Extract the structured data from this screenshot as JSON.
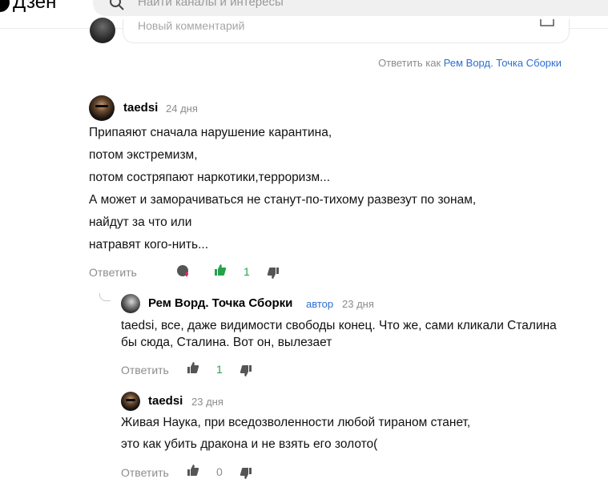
{
  "header": {
    "logo_text": "Дзен",
    "search_placeholder": "Найти каналы и интересы"
  },
  "new_comment": {
    "placeholder": "Новый комментарий"
  },
  "reply_as": {
    "prefix": "Ответить как",
    "name": "Рем Ворд. Точка Сборки"
  },
  "comments": [
    {
      "author": "taedsi",
      "date": "24 дня",
      "lines": [
        "Припаяют сначала нарушение карантина,",
        "потом экстремизм,",
        "потом состряпают наркотики,терроризм...",
        "А может и заморачиваться не станут-по-тихому развезут по зонам,",
        "найдут за что или",
        "натравят кого-нить..."
      ],
      "reply_label": "Ответить",
      "likes": "1"
    },
    {
      "author": "Рем Ворд. Точка Сборки",
      "badge": "автор",
      "date": "23 дня",
      "lines": [
        "taedsi, все, даже видимости свободы конец. Что же, сами кликали Сталина",
        "бы сюда, Сталина. Вот он, вылезает"
      ],
      "reply_label": "Ответить",
      "likes": "1"
    },
    {
      "author": "taedsi",
      "date": "23 дня",
      "lines": [
        "Живая Наука, при вседозволенности любой тираном станет,",
        "это как убить дракона и не взять его золото("
      ],
      "reply_label": "Ответить",
      "likes": "0"
    }
  ],
  "colors": {
    "link_blue": "#2c6fd1",
    "like_green": "#22a34a",
    "muted_gray": "#8c8c8c"
  }
}
